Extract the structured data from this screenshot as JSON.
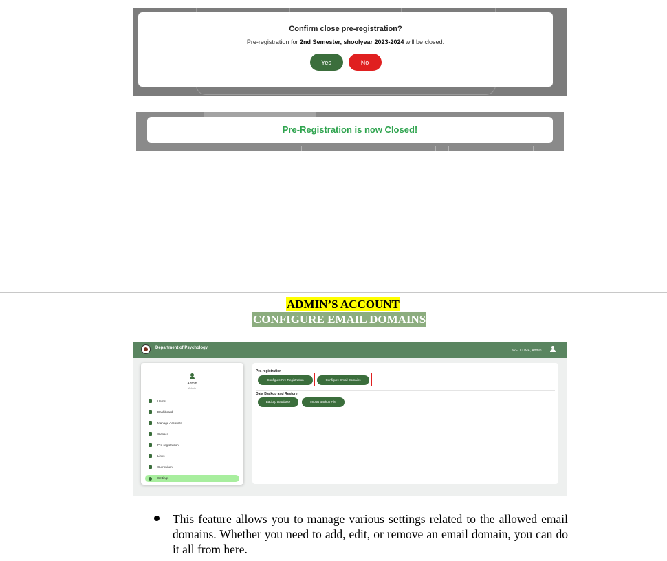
{
  "confirm_dialog": {
    "title": "Confirm close pre-registration?",
    "message_prefix": "Pre-registration for ",
    "message_bold": "2nd Semester, shoolyear 2023-2024",
    "message_suffix": " will be closed.",
    "yes_label": "Yes",
    "no_label": "No",
    "colors": {
      "yes": "#3b6e3c",
      "no": "#e02020"
    }
  },
  "closed_banner": {
    "message": "Pre-Registration is now Closed!",
    "color": "#2fa44f"
  },
  "headings": {
    "account": "ADMIN’S ACCOUNT",
    "section": "CONFIGURE EMAIL DOMAINS"
  },
  "settings_screen": {
    "header": {
      "title": "Department of Psychology",
      "welcome": "WELCOME, Admin"
    },
    "sidebar": {
      "user_name": "Admin",
      "user_role": "Admin",
      "items": [
        {
          "label": "Home",
          "icon": "home-icon"
        },
        {
          "label": "Dashboard",
          "icon": "dashboard-icon"
        },
        {
          "label": "Manage Accounts",
          "icon": "users-icon"
        },
        {
          "label": "Classes",
          "icon": "classes-icon"
        },
        {
          "label": "Pre-registration",
          "icon": "file-icon"
        },
        {
          "label": "Links",
          "icon": "link-icon"
        },
        {
          "label": "Curriculum",
          "icon": "graduation-cap-icon"
        },
        {
          "label": "Settings",
          "icon": "gear-icon",
          "active": true
        }
      ]
    },
    "panel": {
      "preregistration_title": "Pre-registration",
      "configure_prereg_label": "Configure Pre-Registration",
      "configure_email_label": "Configure Email Domains",
      "backup_title": "Data Backup and Restore",
      "backup_db_label": "Backup Database",
      "import_label": "Import Backup File"
    },
    "colors": {
      "header": "#5a8560",
      "button": "#3b6e3c",
      "active_nav": "#a8ee9e",
      "highlight_box": "#e02020"
    }
  },
  "bullet": {
    "text": "This feature allows you to manage various settings related to the allowed email domains. Whether you need to add, edit, or remove an email domain, you can do it all from here."
  }
}
